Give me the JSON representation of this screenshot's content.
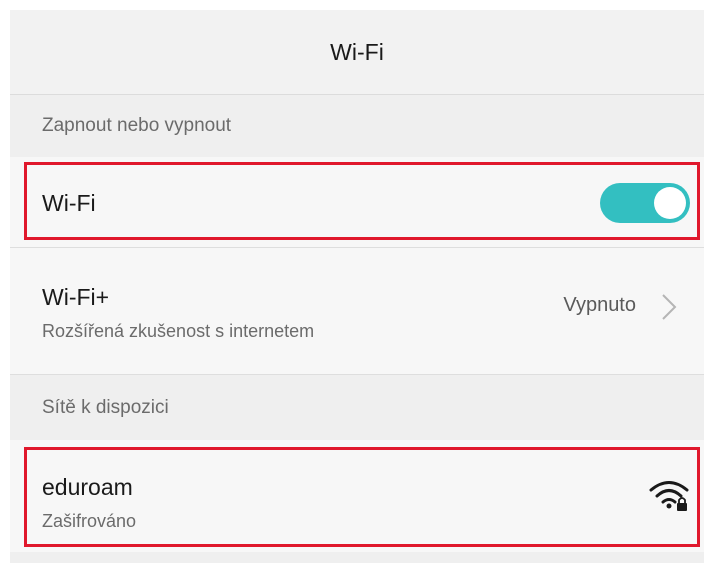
{
  "header": {
    "title": "Wi-Fi"
  },
  "sections": {
    "toggle_section": "Zapnout nebo vypnout",
    "networks_section": "Sítě k dispozici"
  },
  "wifi_row": {
    "label": "Wi-Fi",
    "enabled": true,
    "toggle_color": "#33bfc1"
  },
  "wifi_plus_row": {
    "label": "Wi-Fi+",
    "description": "Rozšířená zkušenost s internetem",
    "value": "Vypnuto"
  },
  "networks": [
    {
      "ssid": "eduroam",
      "security": "Zašifrováno",
      "signal_icon": "wifi-locked-icon"
    }
  ],
  "highlight_color": "#e0182c"
}
